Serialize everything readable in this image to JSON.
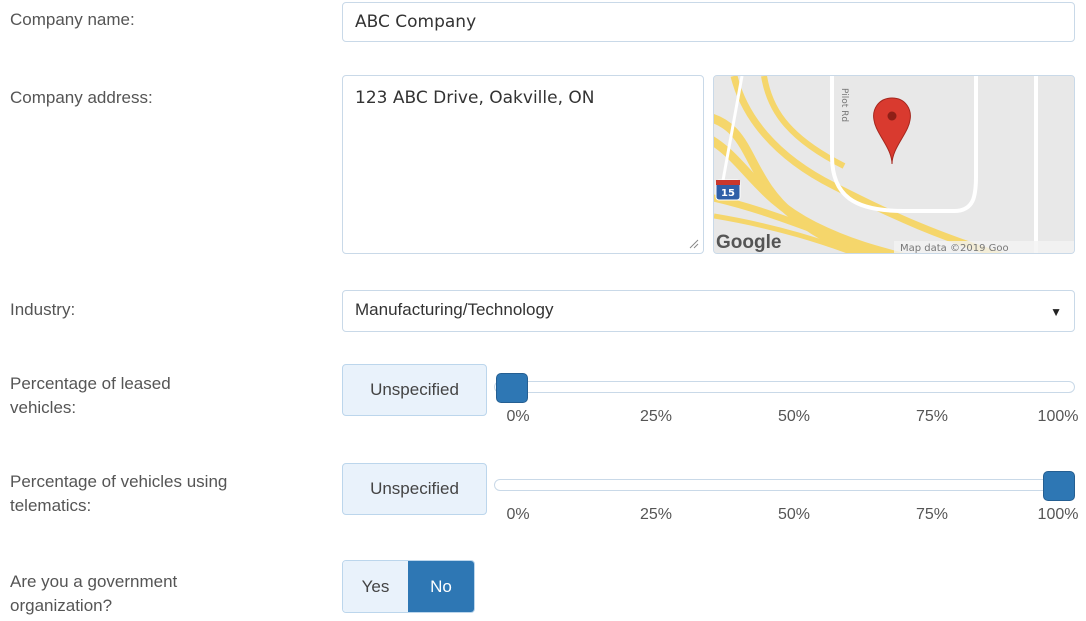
{
  "form": {
    "company_name": {
      "label": "Company name:",
      "value": "ABC Company"
    },
    "company_address": {
      "label": "Company address:",
      "value": "123 ABC Drive, Oakville, ON"
    },
    "map": {
      "road_label": "Pilot Rd",
      "route_shield": "15",
      "logo_text": "Google",
      "attribution": "Map data ©2019 Goo"
    },
    "industry": {
      "label": "Industry:",
      "selected": "Manufacturing/Technology"
    },
    "leased_vehicles": {
      "label_line1": "Percentage of leased",
      "label_line2": "vehicles:",
      "button": "Unspecified",
      "value_percent": 0
    },
    "telematics": {
      "label_line1": "Percentage of vehicles using",
      "label_line2": "telematics:",
      "button": "Unspecified",
      "value_percent": 100
    },
    "ticks": [
      "0%",
      "25%",
      "50%",
      "75%",
      "100%"
    ],
    "government": {
      "label_line1": "Are you a government",
      "label_line2": "organization?",
      "yes": "Yes",
      "no": "No",
      "selected": "No"
    }
  },
  "colors": {
    "accent": "#2e77b4",
    "input_border": "#c9d9e8",
    "button_bg": "#e9f2fb",
    "map_road": "#f5d66b",
    "pin": "#d93a2f"
  }
}
